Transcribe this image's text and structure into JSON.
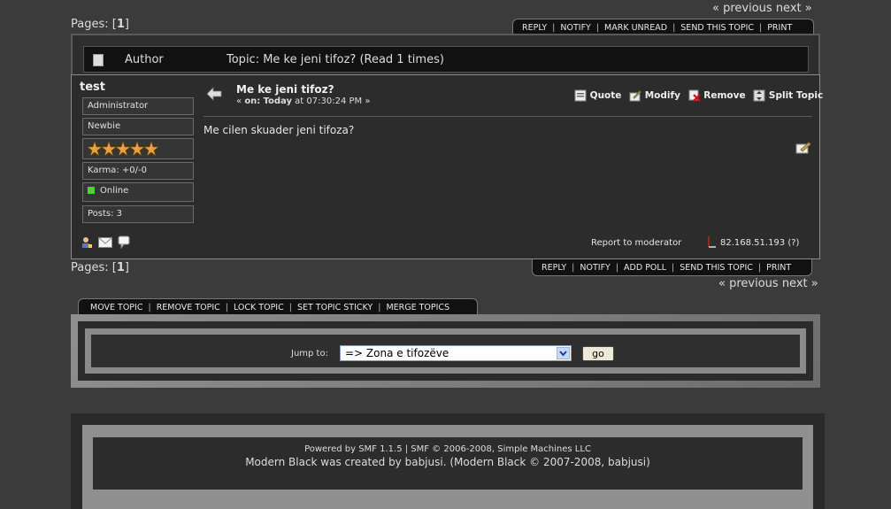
{
  "nav": {
    "prev_label": "« previous",
    "next_label": "next »"
  },
  "pages": {
    "label": "Pages:",
    "current": "1"
  },
  "top_buttons": [
    "REPLY",
    "NOTIFY",
    "MARK UNREAD",
    "SEND THIS TOPIC",
    "PRINT"
  ],
  "bottom_buttons": [
    "REPLY",
    "NOTIFY",
    "ADD POLL",
    "SEND THIS TOPIC",
    "PRINT"
  ],
  "header": {
    "author_label": "Author",
    "topic_text": "Topic: Me ke jeni tifoz?  (Read 1 times)"
  },
  "user": {
    "name": "test",
    "group": "Administrator",
    "rank": "Newbie",
    "karma": "Karma: +0/-0",
    "status": "Online",
    "posts": "Posts: 3",
    "stars": 5
  },
  "post": {
    "title": "Me ke jeni tifoz?",
    "date_prefix": "«",
    "date_on": "on:",
    "date_day": "Today",
    "date_time": "at 07:30:24 PM",
    "date_suffix": "»",
    "body": "Me cilen skuader jeni tifoza?",
    "report_label": "Report to moderator",
    "ip": "82.168.51.193 (?)"
  },
  "post_actions": {
    "quote": "Quote",
    "modify": "Modify",
    "remove": "Remove",
    "split": "Split Topic"
  },
  "mod_buttons": [
    "MOVE TOPIC",
    "REMOVE TOPIC",
    "LOCK TOPIC",
    "SET TOPIC STICKY",
    "MERGE TOPICS"
  ],
  "jump": {
    "label": "Jump to:",
    "selected": "=> Zona e tifozëve",
    "go_label": "go"
  },
  "footer": {
    "line1": "Powered by SMF 1.1.5 | SMF © 2006-2008, Simple Machines LLC",
    "line2": "Modern Black was created by babjusi. (Modern Black © 2007-2008, babjusi)"
  },
  "colors": {
    "background": "#3b3b3b",
    "online": "#4cd13a",
    "star": "#e8a33b"
  }
}
